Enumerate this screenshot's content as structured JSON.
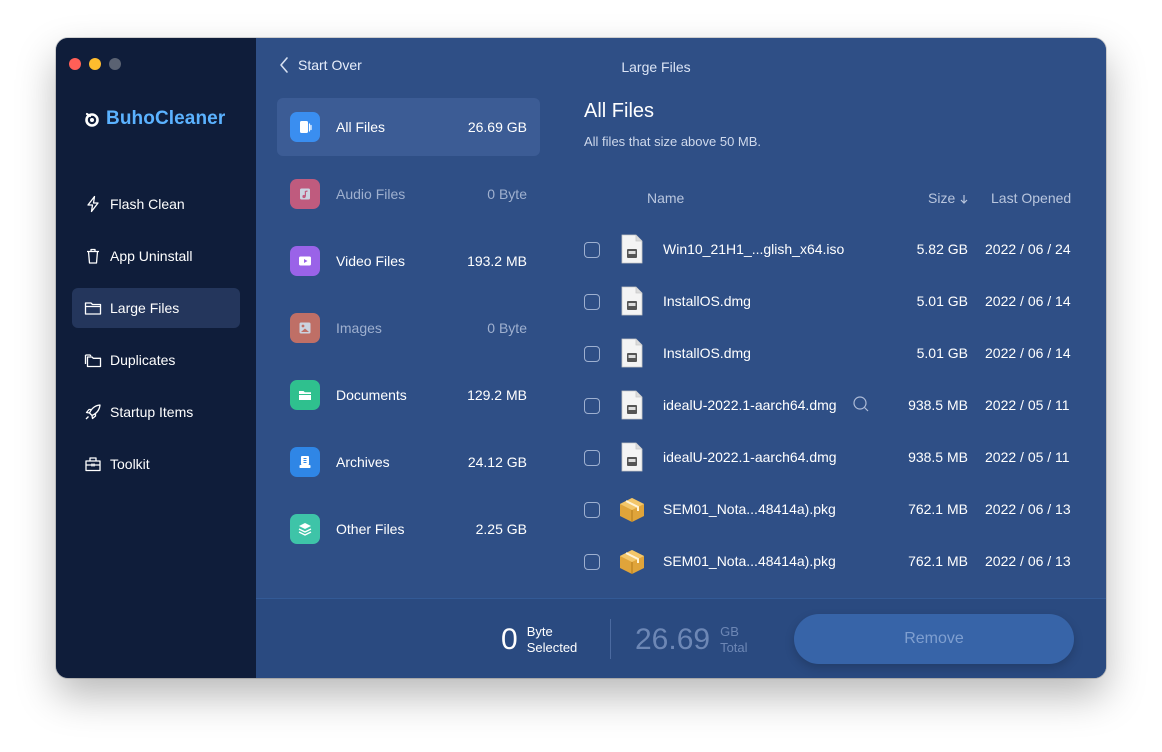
{
  "app": {
    "name": "BuhoCleaner",
    "window_title": "Large Files"
  },
  "colors": {
    "accent": "#3764a8",
    "logo": "#5bb2ff",
    "sidebar": "#0f1d3a",
    "main": "#2f4f86"
  },
  "sidebar": {
    "items": [
      {
        "label": "Flash Clean",
        "icon": "lightning-icon"
      },
      {
        "label": "App Uninstall",
        "icon": "trash-icon"
      },
      {
        "label": "Large Files",
        "icon": "folder-icon",
        "active": true
      },
      {
        "label": "Duplicates",
        "icon": "stacked-folders-icon"
      },
      {
        "label": "Startup Items",
        "icon": "rocket-icon"
      },
      {
        "label": "Toolkit",
        "icon": "toolbox-icon"
      }
    ]
  },
  "header": {
    "back_label": "Start Over"
  },
  "categories": [
    {
      "name": "All Files",
      "size": "26.69 GB",
      "color": "#3a8ef0",
      "icon": "all-files-icon",
      "active": true
    },
    {
      "name": "Audio Files",
      "size": "0 Byte",
      "color": "#ef5f7c",
      "icon": "music-note-icon",
      "dim": true
    },
    {
      "name": "Video Files",
      "size": "193.2 MB",
      "color": "#9a63e8",
      "icon": "play-icon"
    },
    {
      "name": "Images",
      "size": "0 Byte",
      "color": "#f07a5c",
      "icon": "image-icon",
      "dim": true
    },
    {
      "name": "Documents",
      "size": "129.2 MB",
      "color": "#2fc08e",
      "icon": "folder-open-icon"
    },
    {
      "name": "Archives",
      "size": "24.12 GB",
      "color": "#2f86e6",
      "icon": "archive-icon"
    },
    {
      "name": "Other Files",
      "size": "2.25 GB",
      "color": "#3ec4a8",
      "icon": "layers-icon"
    }
  ],
  "content": {
    "title": "All Files",
    "subtitle": "All files that size above 50 MB.",
    "columns": {
      "name": "Name",
      "size": "Size",
      "last_opened": "Last Opened"
    },
    "rows": [
      {
        "name": "Win10_21H1_...glish_x64.iso",
        "size": "5.82 GB",
        "date": "2022 / 06 / 24",
        "type": "disk"
      },
      {
        "name": "InstallOS.dmg",
        "size": "5.01 GB",
        "date": "2022 / 06 / 14",
        "type": "disk"
      },
      {
        "name": "InstallOS.dmg",
        "size": "5.01 GB",
        "date": "2022 / 06 / 14",
        "type": "disk"
      },
      {
        "name": "idealU-2022.1-aarch64.dmg",
        "size": "938.5 MB",
        "date": "2022 / 05 / 11",
        "type": "disk",
        "magnify": true
      },
      {
        "name": "idealU-2022.1-aarch64.dmg",
        "size": "938.5 MB",
        "date": "2022 / 05 / 11",
        "type": "disk"
      },
      {
        "name": "SEM01_Nota...48414a).pkg",
        "size": "762.1 MB",
        "date": "2022 / 06 / 13",
        "type": "package"
      },
      {
        "name": "SEM01_Nota...48414a).pkg",
        "size": "762.1 MB",
        "date": "2022 / 06 / 13",
        "type": "package"
      }
    ]
  },
  "footer": {
    "selected_value": "0",
    "selected_unit": "Byte",
    "selected_label": "Selected",
    "total_value": "26.69",
    "total_unit": "GB",
    "total_label": "Total",
    "remove_label": "Remove"
  }
}
